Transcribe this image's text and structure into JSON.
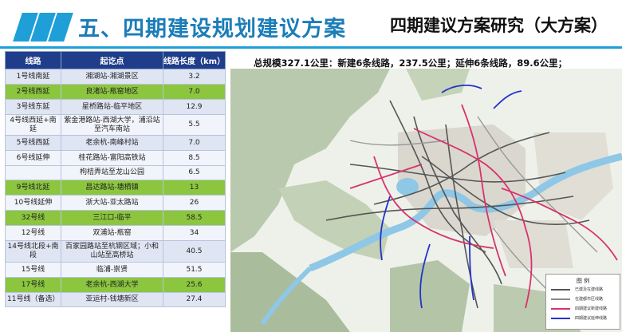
{
  "header": {
    "section_title": "五、四期建设规划建议方案",
    "sub_title": "四期建议方案研究（大方案）"
  },
  "table": {
    "columns": [
      "线路",
      "起讫点",
      "线路长度（km）"
    ],
    "rows": [
      {
        "line": "1号线南延",
        "span": "湘湖站-湘湖景区",
        "length": "3.2",
        "style": "odd"
      },
      {
        "line": "2号线西延",
        "span": "良渚站-瓶窑地区",
        "length": "7.0",
        "style": "hl"
      },
      {
        "line": "3号线东延",
        "span": "星桥路站-临平地区",
        "length": "12.9",
        "style": "odd"
      },
      {
        "line": "4号线西延+南延",
        "span": "紫金港路站-西湖大学，浦沿站至汽车南站",
        "length": "5.5",
        "style": "even"
      },
      {
        "line": "5号线西延",
        "span": "老余杭-南峰村站",
        "length": "7.0",
        "style": "odd"
      },
      {
        "line": "6号线延伸",
        "span": "桂花路站-富阳高铁站",
        "length": "8.5",
        "style": "even"
      },
      {
        "line": "",
        "span": "枸桔弄站至龙山公园",
        "length": "6.5",
        "style": "even"
      },
      {
        "line": "9号线北延",
        "span": "昌达路站-塘栖镇",
        "length": "13",
        "style": "hl"
      },
      {
        "line": "10号线延伸",
        "span": "浙大站-亚太路站",
        "length": "26",
        "style": "even"
      },
      {
        "line": "32号线",
        "span": "三江口-临平",
        "length": "58.5",
        "style": "hl"
      },
      {
        "line": "12号线",
        "span": "双浦站-瓶窑",
        "length": "34",
        "style": "even"
      },
      {
        "line": "14号线北段+南段",
        "span": "百家园路站至杭钢区域；小和山站至高桥站",
        "length": "40.5",
        "style": "odd"
      },
      {
        "line": "15号线",
        "span": "临浦-崇贤",
        "length": "51.5",
        "style": "even"
      },
      {
        "line": "17号线",
        "span": "老余杭-西湖大学",
        "length": "25.6",
        "style": "hl"
      },
      {
        "line": "11号线（备选）",
        "span": "亚运村-钱塘新区",
        "length": "27.4",
        "style": "odd"
      }
    ]
  },
  "summary": "总规模327.1公里：新建6条线路，237.5公里；延伸6条线路，89.6公里；",
  "legend": {
    "title": "图 例",
    "items": [
      {
        "label": "已建及在建线路",
        "color": "#555555"
      },
      {
        "label": "在建都市区线路",
        "color": "#888888"
      },
      {
        "label": "四期建议新建线路",
        "color": "#d6336c"
      },
      {
        "label": "四期建议延伸线路",
        "color": "#2233cc"
      }
    ]
  },
  "colors": {
    "accent": "#1e9fd8",
    "table_header": "#1f3d8a",
    "highlight_row": "#8cc63f",
    "new_line": "#d6336c",
    "extension_line": "#2233cc"
  }
}
